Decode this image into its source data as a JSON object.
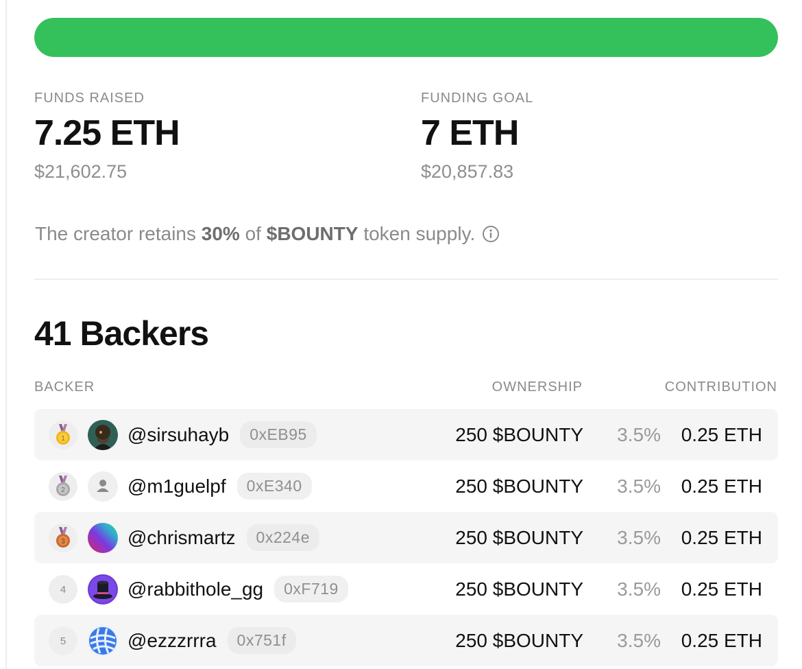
{
  "funding": {
    "progress_fraction": 1.0,
    "raised_label": "FUNDS RAISED",
    "raised_value": "7.25 ETH",
    "raised_usd": "$21,602.75",
    "goal_label": "FUNDING GOAL",
    "goal_value": "7 ETH",
    "goal_usd": "$20,857.83"
  },
  "retain": {
    "prefix": "The creator retains",
    "percent": "30%",
    "middle": "of",
    "token": "$BOUNTY",
    "suffix": "token supply."
  },
  "backers": {
    "title": "41 Backers",
    "headers": {
      "backer": "BACKER",
      "ownership": "OWNERSHIP",
      "contribution": "CONTRIBUTION"
    },
    "rows": [
      {
        "rank": "1",
        "medal": "gold-medal-icon",
        "avatar": "photo-avatar",
        "handle": "@sirsuhayb",
        "address": "0xEB95",
        "ownership": "250 $BOUNTY",
        "percent": "3.5%",
        "contribution": "0.25 ETH"
      },
      {
        "rank": "2",
        "medal": "silver-medal-icon",
        "avatar": "default-user-avatar",
        "handle": "@m1guelpf",
        "address": "0xE340",
        "ownership": "250 $BOUNTY",
        "percent": "3.5%",
        "contribution": "0.25 ETH"
      },
      {
        "rank": "3",
        "medal": "bronze-medal-icon",
        "avatar": "gradient-avatar",
        "handle": "@chrismartz",
        "address": "0x224e",
        "ownership": "250 $BOUNTY",
        "percent": "3.5%",
        "contribution": "0.25 ETH"
      },
      {
        "rank": "4",
        "medal": "",
        "avatar": "purple-hat-avatar",
        "handle": "@rabbithole_gg",
        "address": "0xF719",
        "ownership": "250 $BOUNTY",
        "percent": "3.5%",
        "contribution": "0.25 ETH"
      },
      {
        "rank": "5",
        "medal": "",
        "avatar": "blue-globe-avatar",
        "handle": "@ezzzrrra",
        "address": "0x751f",
        "ownership": "250 $BOUNTY",
        "percent": "3.5%",
        "contribution": "0.25 ETH"
      }
    ]
  },
  "colors": {
    "progress": "#34c05a",
    "muted_text": "#8a8a8a",
    "row_shade": "#f5f5f5"
  }
}
